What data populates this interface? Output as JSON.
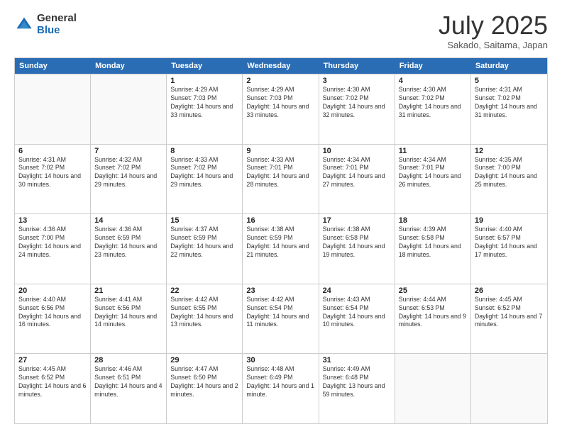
{
  "logo": {
    "general": "General",
    "blue": "Blue"
  },
  "header": {
    "month": "July 2025",
    "location": "Sakado, Saitama, Japan"
  },
  "weekdays": [
    "Sunday",
    "Monday",
    "Tuesday",
    "Wednesday",
    "Thursday",
    "Friday",
    "Saturday"
  ],
  "rows": [
    [
      {
        "day": "",
        "empty": true
      },
      {
        "day": "",
        "empty": true
      },
      {
        "day": "1",
        "sunrise": "Sunrise: 4:29 AM",
        "sunset": "Sunset: 7:03 PM",
        "daylight": "Daylight: 14 hours and 33 minutes."
      },
      {
        "day": "2",
        "sunrise": "Sunrise: 4:29 AM",
        "sunset": "Sunset: 7:03 PM",
        "daylight": "Daylight: 14 hours and 33 minutes."
      },
      {
        "day": "3",
        "sunrise": "Sunrise: 4:30 AM",
        "sunset": "Sunset: 7:02 PM",
        "daylight": "Daylight: 14 hours and 32 minutes."
      },
      {
        "day": "4",
        "sunrise": "Sunrise: 4:30 AM",
        "sunset": "Sunset: 7:02 PM",
        "daylight": "Daylight: 14 hours and 31 minutes."
      },
      {
        "day": "5",
        "sunrise": "Sunrise: 4:31 AM",
        "sunset": "Sunset: 7:02 PM",
        "daylight": "Daylight: 14 hours and 31 minutes."
      }
    ],
    [
      {
        "day": "6",
        "sunrise": "Sunrise: 4:31 AM",
        "sunset": "Sunset: 7:02 PM",
        "daylight": "Daylight: 14 hours and 30 minutes."
      },
      {
        "day": "7",
        "sunrise": "Sunrise: 4:32 AM",
        "sunset": "Sunset: 7:02 PM",
        "daylight": "Daylight: 14 hours and 29 minutes."
      },
      {
        "day": "8",
        "sunrise": "Sunrise: 4:33 AM",
        "sunset": "Sunset: 7:02 PM",
        "daylight": "Daylight: 14 hours and 29 minutes."
      },
      {
        "day": "9",
        "sunrise": "Sunrise: 4:33 AM",
        "sunset": "Sunset: 7:01 PM",
        "daylight": "Daylight: 14 hours and 28 minutes."
      },
      {
        "day": "10",
        "sunrise": "Sunrise: 4:34 AM",
        "sunset": "Sunset: 7:01 PM",
        "daylight": "Daylight: 14 hours and 27 minutes."
      },
      {
        "day": "11",
        "sunrise": "Sunrise: 4:34 AM",
        "sunset": "Sunset: 7:01 PM",
        "daylight": "Daylight: 14 hours and 26 minutes."
      },
      {
        "day": "12",
        "sunrise": "Sunrise: 4:35 AM",
        "sunset": "Sunset: 7:00 PM",
        "daylight": "Daylight: 14 hours and 25 minutes."
      }
    ],
    [
      {
        "day": "13",
        "sunrise": "Sunrise: 4:36 AM",
        "sunset": "Sunset: 7:00 PM",
        "daylight": "Daylight: 14 hours and 24 minutes."
      },
      {
        "day": "14",
        "sunrise": "Sunrise: 4:36 AM",
        "sunset": "Sunset: 6:59 PM",
        "daylight": "Daylight: 14 hours and 23 minutes."
      },
      {
        "day": "15",
        "sunrise": "Sunrise: 4:37 AM",
        "sunset": "Sunset: 6:59 PM",
        "daylight": "Daylight: 14 hours and 22 minutes."
      },
      {
        "day": "16",
        "sunrise": "Sunrise: 4:38 AM",
        "sunset": "Sunset: 6:59 PM",
        "daylight": "Daylight: 14 hours and 21 minutes."
      },
      {
        "day": "17",
        "sunrise": "Sunrise: 4:38 AM",
        "sunset": "Sunset: 6:58 PM",
        "daylight": "Daylight: 14 hours and 19 minutes."
      },
      {
        "day": "18",
        "sunrise": "Sunrise: 4:39 AM",
        "sunset": "Sunset: 6:58 PM",
        "daylight": "Daylight: 14 hours and 18 minutes."
      },
      {
        "day": "19",
        "sunrise": "Sunrise: 4:40 AM",
        "sunset": "Sunset: 6:57 PM",
        "daylight": "Daylight: 14 hours and 17 minutes."
      }
    ],
    [
      {
        "day": "20",
        "sunrise": "Sunrise: 4:40 AM",
        "sunset": "Sunset: 6:56 PM",
        "daylight": "Daylight: 14 hours and 16 minutes."
      },
      {
        "day": "21",
        "sunrise": "Sunrise: 4:41 AM",
        "sunset": "Sunset: 6:56 PM",
        "daylight": "Daylight: 14 hours and 14 minutes."
      },
      {
        "day": "22",
        "sunrise": "Sunrise: 4:42 AM",
        "sunset": "Sunset: 6:55 PM",
        "daylight": "Daylight: 14 hours and 13 minutes."
      },
      {
        "day": "23",
        "sunrise": "Sunrise: 4:42 AM",
        "sunset": "Sunset: 6:54 PM",
        "daylight": "Daylight: 14 hours and 11 minutes."
      },
      {
        "day": "24",
        "sunrise": "Sunrise: 4:43 AM",
        "sunset": "Sunset: 6:54 PM",
        "daylight": "Daylight: 14 hours and 10 minutes."
      },
      {
        "day": "25",
        "sunrise": "Sunrise: 4:44 AM",
        "sunset": "Sunset: 6:53 PM",
        "daylight": "Daylight: 14 hours and 9 minutes."
      },
      {
        "day": "26",
        "sunrise": "Sunrise: 4:45 AM",
        "sunset": "Sunset: 6:52 PM",
        "daylight": "Daylight: 14 hours and 7 minutes."
      }
    ],
    [
      {
        "day": "27",
        "sunrise": "Sunrise: 4:45 AM",
        "sunset": "Sunset: 6:52 PM",
        "daylight": "Daylight: 14 hours and 6 minutes."
      },
      {
        "day": "28",
        "sunrise": "Sunrise: 4:46 AM",
        "sunset": "Sunset: 6:51 PM",
        "daylight": "Daylight: 14 hours and 4 minutes."
      },
      {
        "day": "29",
        "sunrise": "Sunrise: 4:47 AM",
        "sunset": "Sunset: 6:50 PM",
        "daylight": "Daylight: 14 hours and 2 minutes."
      },
      {
        "day": "30",
        "sunrise": "Sunrise: 4:48 AM",
        "sunset": "Sunset: 6:49 PM",
        "daylight": "Daylight: 14 hours and 1 minute."
      },
      {
        "day": "31",
        "sunrise": "Sunrise: 4:49 AM",
        "sunset": "Sunset: 6:48 PM",
        "daylight": "Daylight: 13 hours and 59 minutes."
      },
      {
        "day": "",
        "empty": true
      },
      {
        "day": "",
        "empty": true
      }
    ]
  ]
}
